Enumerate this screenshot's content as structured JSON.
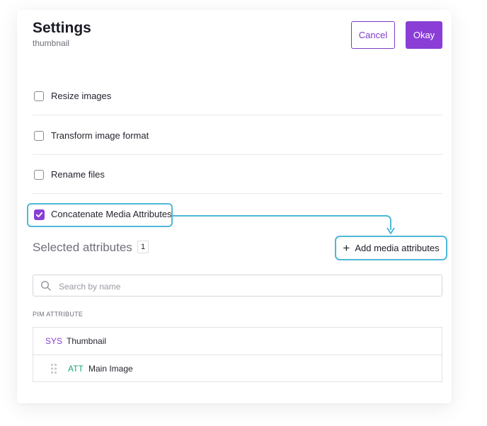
{
  "header": {
    "title": "Settings",
    "subtitle": "thumbnail",
    "cancel_label": "Cancel",
    "okay_label": "Okay"
  },
  "options": [
    {
      "label": "Resize images",
      "checked": false
    },
    {
      "label": "Transform image format",
      "checked": false
    },
    {
      "label": "Rename files",
      "checked": false
    },
    {
      "label": "Concatenate Media Attributes",
      "checked": true
    }
  ],
  "selected": {
    "title": "Selected attributes",
    "count": "1",
    "add_label": "Add media attributes"
  },
  "search": {
    "placeholder": "Search by name",
    "value": ""
  },
  "table": {
    "column_header": "PIM ATTRIBUTE",
    "rows": [
      {
        "tag": "SYS",
        "name": "Thumbnail"
      },
      {
        "tag": "ATT",
        "name": "Main Image"
      }
    ]
  },
  "colors": {
    "accent": "#8a3ed6",
    "highlight": "#4fb8d8",
    "att_tag": "#1aa37a"
  },
  "icons": [
    "check-icon",
    "plus-icon",
    "search-icon",
    "drag-handle-icon",
    "arrow-connector-icon"
  ]
}
